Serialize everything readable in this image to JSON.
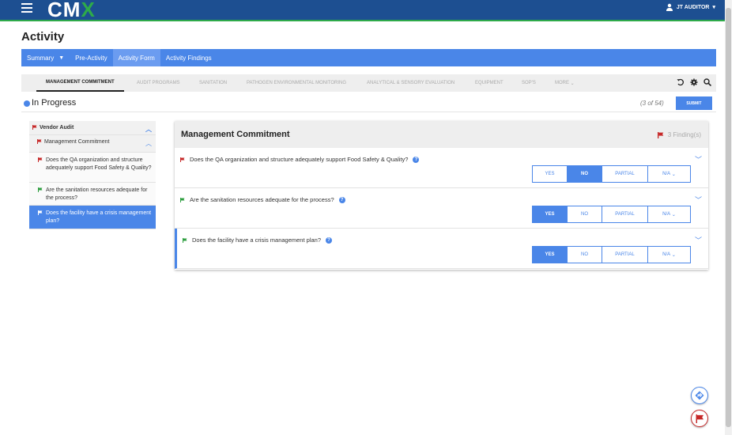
{
  "app": {
    "logo_prefix": "C",
    "logo_mid": "M",
    "logo_accent": "X",
    "user": "JT AUDITOR"
  },
  "page": {
    "title": "Activity"
  },
  "nav": [
    {
      "label": "Summary"
    },
    {
      "label": "Pre-Activity"
    },
    {
      "label": "Activity Form"
    },
    {
      "label": "Activity Findings"
    }
  ],
  "tabs": [
    {
      "label": "MANAGEMENT COMMITMENT"
    },
    {
      "label": "AUDIT PROGRAMS"
    },
    {
      "label": "SANITATION"
    },
    {
      "label": "PATHOGEN ENVIRONMENTAL MONITORING"
    },
    {
      "label": "ANALYTICAL & SENSORY EVALUATION"
    },
    {
      "label": "EQUIPMENT"
    },
    {
      "label": "SOP'S"
    },
    {
      "label": "MORE"
    }
  ],
  "status": {
    "text": "In Progress",
    "count": "(3 of 54)",
    "submit_label": "SUBMIT"
  },
  "tree": {
    "root": "Vendor Audit",
    "section": "Management Commitment",
    "items": [
      {
        "label": "Does the QA organization and structure adequately support Food Safety & Quality?",
        "flag": "red"
      },
      {
        "label": "Are the sanitation resources adequate for the process?",
        "flag": "green"
      },
      {
        "label": "Does the facility have a crisis management plan?",
        "flag": "green"
      }
    ]
  },
  "main": {
    "title": "Management Commitment",
    "findings": "3 Finding(s)",
    "questions": [
      {
        "text": "Does the QA organization and structure adequately support Food Safety & Quality?",
        "flag": "red",
        "selected": "NO"
      },
      {
        "text": "Are the sanitation resources adequate for the process?",
        "flag": "green",
        "selected": "YES"
      },
      {
        "text": "Does the facility have a crisis management plan?",
        "flag": "green",
        "selected": "YES"
      }
    ],
    "options": {
      "yes": "YES",
      "no": "NO",
      "partial": "PARTIAL",
      "na": "N/A"
    }
  },
  "colors": {
    "primary": "#4a86e8",
    "header": "#1d4f91",
    "red_flag": "#c62828",
    "green_flag": "#2e9e3f"
  }
}
